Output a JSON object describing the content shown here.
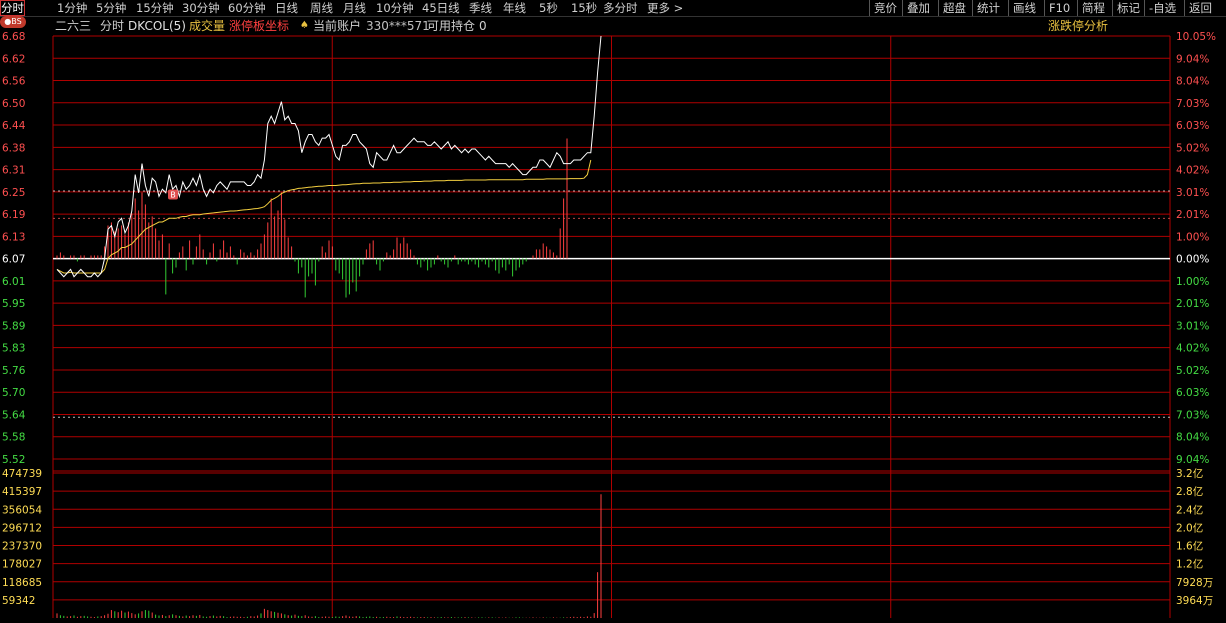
{
  "toolbar": {
    "periods": [
      "分时",
      "1分钟",
      "5分钟",
      "15分钟",
      "30分钟",
      "60分钟",
      "日线",
      "周线",
      "月线",
      "10分钟",
      "45日线",
      "季线",
      "年线",
      "5秒",
      "15秒",
      "多分时",
      "更多 >"
    ],
    "active": "分时",
    "right": [
      "竞价",
      "叠加",
      "超盘",
      "统计",
      "画线",
      "F10",
      "简程",
      "标记",
      "-自选",
      "返回"
    ]
  },
  "infobar": {
    "badge": "●BS",
    "name": "二六三",
    "mode": "分时",
    "indicator": "DKCOL(5)",
    "volume": "成交量",
    "coord": "涨停板坐标",
    "account_icon": "♠",
    "account_label": "当前账户",
    "account_no": "330***571",
    "holdings_label": "可用持仓",
    "holdings_value": "0",
    "analysis": "涨跌停分析"
  },
  "colors": {
    "grid": "#b00000",
    "up": "#ff4040",
    "down": "#33cc33",
    "price_line": "#ffffff",
    "avg_line": "#f5d040",
    "base": "#ffffff"
  },
  "chart_data": {
    "type": "line",
    "base_price": 6.07,
    "price_ylim": [
      5.52,
      6.68
    ],
    "price_ticks_left": [
      "6.68",
      "6.62",
      "6.56",
      "6.50",
      "6.44",
      "6.38",
      "6.31",
      "6.25",
      "6.19",
      "6.13",
      "6.07",
      "6.01",
      "5.95",
      "5.89",
      "5.83",
      "5.76",
      "5.70",
      "5.64",
      "5.58",
      "5.52"
    ],
    "price_ticks_right": [
      "10.05%",
      "9.04%",
      "8.04%",
      "7.03%",
      "6.03%",
      "5.02%",
      "4.02%",
      "3.01%",
      "2.01%",
      "1.00%",
      "0.00%",
      "1.00%",
      "2.01%",
      "3.01%",
      "4.02%",
      "5.02%",
      "6.03%",
      "7.03%",
      "8.04%",
      "9.04%"
    ],
    "marker": {
      "label": "B",
      "time_index": 30,
      "price": 6.24
    },
    "total_minutes": 240,
    "price": [
      6.04,
      6.03,
      6.02,
      6.03,
      6.04,
      6.02,
      6.03,
      6.04,
      6.03,
      6.02,
      6.02,
      6.03,
      6.02,
      6.03,
      6.07,
      6.15,
      6.16,
      6.13,
      6.17,
      6.18,
      6.14,
      6.16,
      6.2,
      6.3,
      6.25,
      6.33,
      6.27,
      6.24,
      6.29,
      6.28,
      6.24,
      6.26,
      6.25,
      6.3,
      6.26,
      6.27,
      6.24,
      6.28,
      6.26,
      6.27,
      6.29,
      6.27,
      6.3,
      6.26,
      6.24,
      6.26,
      6.25,
      6.27,
      6.28,
      6.27,
      6.26,
      6.28,
      6.28,
      6.28,
      6.28,
      6.28,
      6.27,
      6.27,
      6.28,
      6.3,
      6.29,
      6.34,
      6.44,
      6.46,
      6.44,
      6.47,
      6.5,
      6.45,
      6.46,
      6.44,
      6.44,
      6.42,
      6.36,
      6.39,
      6.41,
      6.41,
      6.39,
      6.38,
      6.4,
      6.4,
      6.41,
      6.38,
      6.35,
      6.34,
      6.38,
      6.38,
      6.39,
      6.41,
      6.41,
      6.39,
      6.38,
      6.37,
      6.33,
      6.32,
      6.36,
      6.35,
      6.34,
      6.34,
      6.36,
      6.38,
      6.36,
      6.36,
      6.37,
      6.38,
      6.39,
      6.4,
      6.39,
      6.39,
      6.39,
      6.38,
      6.38,
      6.39,
      6.38,
      6.37,
      6.38,
      6.39,
      6.37,
      6.38,
      6.37,
      6.36,
      6.37,
      6.36,
      6.37,
      6.37,
      6.36,
      6.35,
      6.34,
      6.35,
      6.34,
      6.33,
      6.33,
      6.33,
      6.33,
      6.32,
      6.33,
      6.32,
      6.31,
      6.3,
      6.3,
      6.31,
      6.32,
      6.32,
      6.34,
      6.34,
      6.33,
      6.32,
      6.34,
      6.36,
      6.35,
      6.33,
      6.33,
      6.33,
      6.34,
      6.34,
      6.34,
      6.35,
      6.36,
      6.36,
      6.46,
      6.58,
      6.68
    ],
    "avg": [
      6.04,
      6.035,
      6.03,
      6.03,
      6.032,
      6.03,
      6.03,
      6.03,
      6.03,
      6.03,
      6.03,
      6.03,
      6.03,
      6.03,
      6.04,
      6.07,
      6.08,
      6.085,
      6.09,
      6.1,
      6.1,
      6.105,
      6.11,
      6.12,
      6.13,
      6.14,
      6.15,
      6.155,
      6.16,
      6.165,
      6.17,
      6.17,
      6.175,
      6.18,
      6.18,
      6.18,
      6.183,
      6.185,
      6.185,
      6.188,
      6.19,
      6.19,
      6.19,
      6.192,
      6.193,
      6.194,
      6.195,
      6.196,
      6.197,
      6.198,
      6.199,
      6.2,
      6.2,
      6.201,
      6.202,
      6.203,
      6.204,
      6.205,
      6.206,
      6.207,
      6.209,
      6.212,
      6.22,
      6.23,
      6.235,
      6.24,
      6.248,
      6.252,
      6.256,
      6.258,
      6.26,
      6.262,
      6.263,
      6.264,
      6.265,
      6.266,
      6.267,
      6.268,
      6.268,
      6.269,
      6.27,
      6.27,
      6.27,
      6.271,
      6.272,
      6.272,
      6.273,
      6.274,
      6.275,
      6.275,
      6.276,
      6.276,
      6.276,
      6.277,
      6.277,
      6.277,
      6.278,
      6.278,
      6.278,
      6.279,
      6.279,
      6.279,
      6.28,
      6.28,
      6.28,
      6.281,
      6.281,
      6.281,
      6.282,
      6.282,
      6.282,
      6.283,
      6.283,
      6.283,
      6.283,
      6.284,
      6.284,
      6.284,
      6.284,
      6.284,
      6.285,
      6.285,
      6.285,
      6.285,
      6.285,
      6.285,
      6.285,
      6.286,
      6.286,
      6.286,
      6.286,
      6.286,
      6.286,
      6.286,
      6.286,
      6.286,
      6.286,
      6.286,
      6.287,
      6.287,
      6.287,
      6.287,
      6.287,
      6.287,
      6.288,
      6.288,
      6.288,
      6.288,
      6.288,
      6.288,
      6.288,
      6.289,
      6.289,
      6.289,
      6.289,
      6.29,
      6.3,
      6.34
    ],
    "dkcol": [
      1,
      2,
      1,
      0,
      1,
      1,
      -1,
      1,
      1,
      0,
      1,
      1,
      1,
      1,
      4,
      11,
      12,
      9,
      10,
      11,
      8,
      12,
      15,
      20,
      16,
      22,
      18,
      12,
      14,
      10,
      6,
      8,
      -12,
      5,
      -5,
      -3,
      2,
      4,
      -4,
      6,
      -2,
      4,
      8,
      3,
      -2,
      2,
      5,
      -1,
      3,
      6,
      2,
      4,
      1,
      -2,
      3,
      2,
      1,
      2,
      1,
      3,
      5,
      8,
      12,
      20,
      14,
      16,
      22,
      13,
      7,
      4,
      -1,
      -5,
      -3,
      -13,
      -6,
      -5,
      -9,
      -1,
      4,
      2,
      6,
      4,
      -4,
      -5,
      -7,
      -13,
      -12,
      -8,
      -11,
      -6,
      -2,
      3,
      5,
      6,
      -2,
      -4,
      -1,
      2,
      1,
      3,
      7,
      5,
      7,
      5,
      3,
      1,
      -2,
      -3,
      -1,
      -4,
      -3,
      -2,
      1,
      -1,
      -2,
      -3,
      -1,
      1,
      -2,
      -1,
      -1,
      -2,
      -1,
      -2,
      -3,
      -1,
      -2,
      -3,
      -1,
      -4,
      -5,
      -3,
      -4,
      -2,
      -6,
      -4,
      -3,
      -2,
      -1,
      0,
      1,
      3,
      3,
      5,
      4,
      3,
      2,
      1,
      10,
      20,
      40
    ],
    "volume_ticks_left": [
      "474739",
      "415397",
      "356054",
      "296712",
      "237370",
      "178027",
      "118685",
      "59342"
    ],
    "volume_ticks_right": [
      "3.2亿",
      "2.8亿",
      "2.4亿",
      "2.0亿",
      "1.6亿",
      "1.2亿",
      "7928万",
      "3964万"
    ],
    "volume_ylim": [
      0,
      474739
    ],
    "volume": [
      15000,
      9000,
      7000,
      5000,
      6000,
      8000,
      4000,
      6000,
      7000,
      5000,
      4000,
      3000,
      5000,
      6000,
      9000,
      14000,
      26000,
      22000,
      19000,
      24000,
      18000,
      21000,
      16000,
      12000,
      15000,
      22000,
      26000,
      24000,
      18000,
      11000,
      8000,
      10000,
      6000,
      9000,
      12000,
      9000,
      7000,
      5000,
      8000,
      6000,
      9000,
      7000,
      10000,
      5000,
      4000,
      6000,
      8000,
      5000,
      7000,
      6000,
      3000,
      4000,
      5000,
      4000,
      4000,
      3000,
      4000,
      6000,
      5000,
      8000,
      15000,
      30000,
      26000,
      22000,
      20000,
      17000,
      15000,
      12000,
      9000,
      8000,
      11000,
      7000,
      6000,
      9000,
      5000,
      4000,
      6000,
      3000,
      4000,
      5000,
      4000,
      3000,
      5000,
      4000,
      6000,
      8000,
      5000,
      4000,
      6000,
      5000,
      3000,
      4000,
      5000,
      3000,
      4000,
      3000,
      3000,
      4000,
      3000,
      3000,
      5000,
      4000,
      3000,
      3000,
      4000,
      3000,
      2000,
      3000,
      3000,
      2000,
      3000,
      2000,
      2000,
      3000,
      2000,
      2000,
      3000,
      2000,
      2000,
      2000,
      3000,
      2000,
      2000,
      1000,
      2000,
      2000,
      1000,
      2000,
      2000,
      1000,
      2000,
      1000,
      2000,
      1000,
      1000,
      2000,
      2000,
      1000,
      1000,
      1000,
      2000,
      1000,
      1000,
      2000,
      1000,
      1000,
      2000,
      1000,
      1000,
      2000,
      2000,
      3000,
      4000,
      3000,
      4000,
      3000,
      5000,
      4000,
      16000,
      150000,
      405000
    ]
  }
}
